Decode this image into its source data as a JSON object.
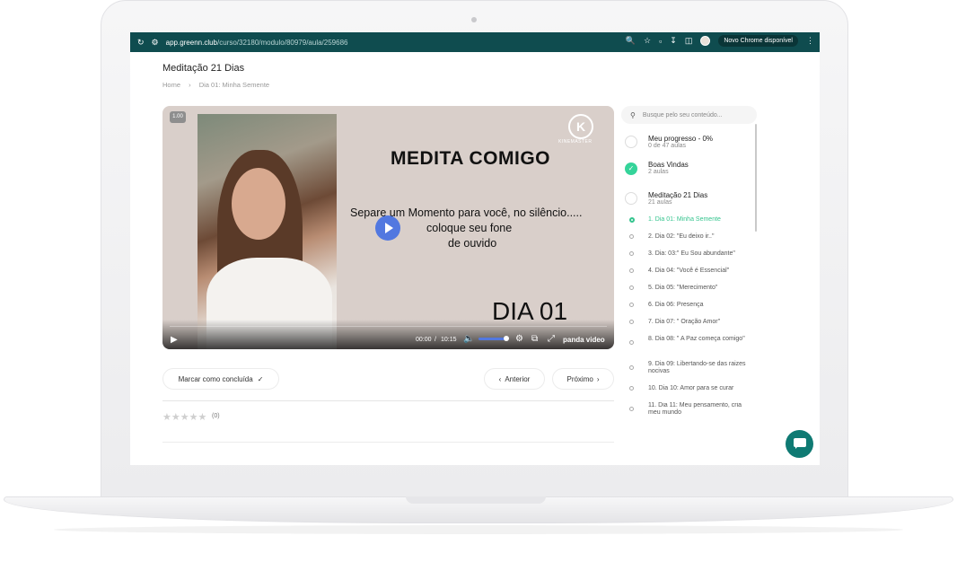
{
  "browser": {
    "url_host": "app.greenn.club",
    "url_path": "/curso/32180/modulo/80979/aula/259686",
    "update_label": "Novo Chrome disponível"
  },
  "page": {
    "title": "Meditação 21 Dias",
    "breadcrumb": [
      "Home",
      "Dia 01: Minha Semente"
    ]
  },
  "video": {
    "speed": "1.00",
    "logo_caption": "KINEMASTER",
    "heading": "MEDITA COMIGO",
    "line1": "Separe um Momento para você, no silêncio.....",
    "line2": "coloque seu fone",
    "line3": "de ouvido",
    "day": "DIA 01",
    "time_current": "00:00",
    "time_total": "10:15",
    "brand": "panda video",
    "volume": 0.85
  },
  "actions": {
    "mark_done": "Marcar como concluída",
    "previous": "Anterior",
    "next": "Próximo"
  },
  "rating": {
    "count": "(0)"
  },
  "sidebar": {
    "search_placeholder": "Busque pelo seu conteúdo...",
    "modules": [
      {
        "title": "Meu progresso - 0%",
        "sub": "0 de 47 aulas",
        "done": false
      },
      {
        "title": "Boas Vindas",
        "sub": "2 aulas",
        "done": true
      },
      {
        "title": "Meditação 21 Dias",
        "sub": "21 aulas",
        "done": false
      }
    ],
    "lessons": [
      "1. Dia 01: Minha Semente",
      "2. Dia 02: \"Eu deixo ir..\"",
      "3. Dia: 03:\" Eu Sou abundante\"",
      "4. Dia 04: \"Você é Essencial\"",
      "5. Dia 05: \"Merecimento\"",
      "6. Dia 06: Presença",
      "7. Dia 07: \" Oração Amor\"",
      "8. Dia 08: \" A Paz começa comigo\"",
      "9. Dia 09: Libertando-se das raizes nocivas",
      "10. Dia 10: Amor para se curar",
      "11. Dia 11: Meu pensamento, cria meu mundo"
    ]
  },
  "colors": {
    "brand_teal": "#0f4c4f",
    "accent_green": "#35d49a",
    "play_blue": "#5278e0"
  }
}
